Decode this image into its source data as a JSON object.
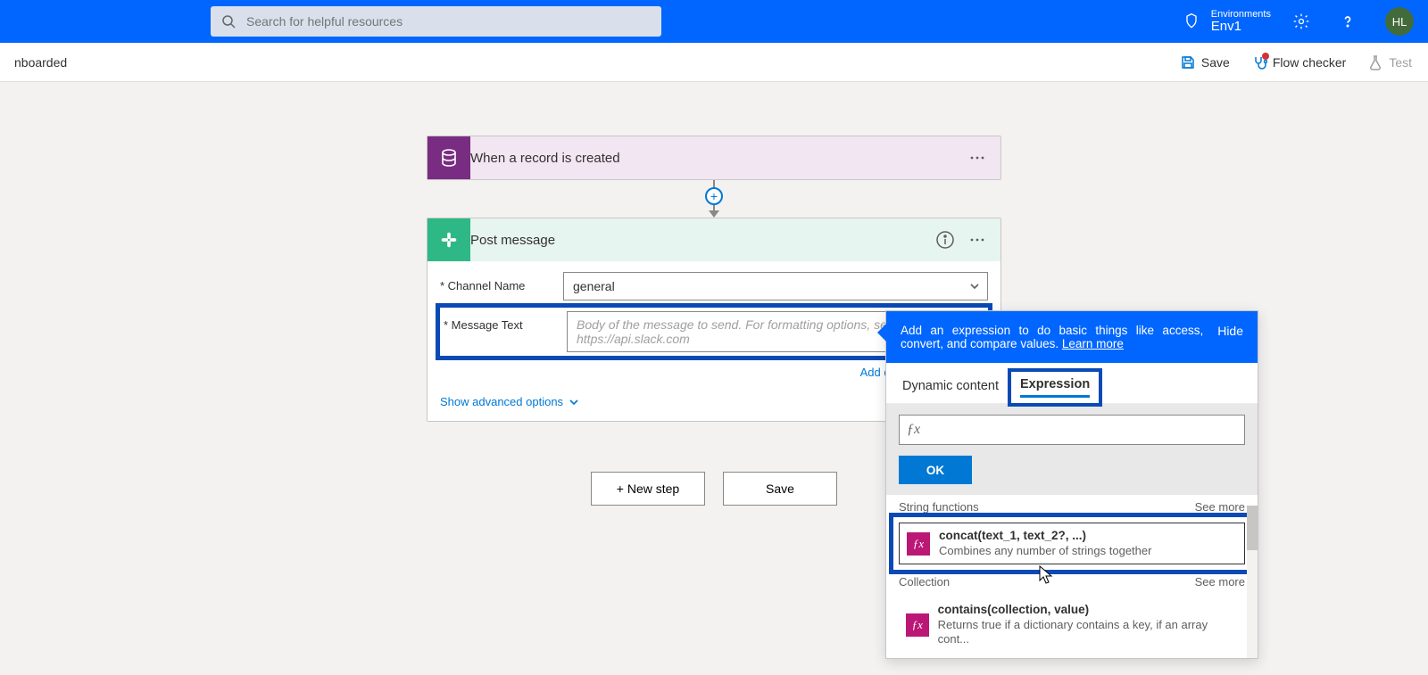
{
  "header": {
    "search_placeholder": "Search for helpful resources",
    "env_label": "Environments",
    "env_name": "Env1",
    "avatar_initials": "HL"
  },
  "cmdbar": {
    "left_text": "nboarded",
    "save": "Save",
    "flow_checker": "Flow checker",
    "test": "Test"
  },
  "trigger": {
    "title": "When a record is created"
  },
  "action": {
    "title": "Post message",
    "fields": {
      "channel_label": "* Channel Name",
      "channel_value": "general",
      "message_label": "* Message Text",
      "message_placeholder": "Body of the message to send. For formatting options, see https://api.slack.com"
    },
    "add_dynamic": "Add dynamic content",
    "show_advanced": "Show advanced options"
  },
  "buttons": {
    "new_step": "+ New step",
    "save": "Save"
  },
  "panel": {
    "header_text": "Add an expression to do basic things like access, convert, and compare values. ",
    "learn_more": "Learn more",
    "hide": "Hide",
    "tab_dynamic": "Dynamic content",
    "tab_expression": "Expression",
    "ok": "OK",
    "sections": [
      {
        "title": "String functions",
        "see_more": "See more"
      },
      {
        "title": "Collection",
        "see_more": "See more"
      }
    ],
    "functions": {
      "concat_sig": "concat(text_1, text_2?, ...)",
      "concat_desc": "Combines any number of strings together",
      "contains_sig": "contains(collection, value)",
      "contains_desc": "Returns true if a dictionary contains a key, if an array cont..."
    }
  }
}
